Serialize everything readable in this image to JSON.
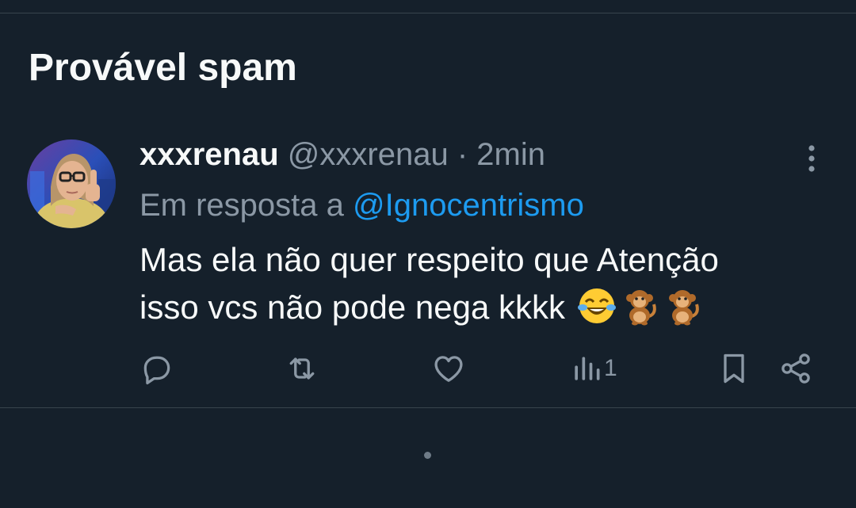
{
  "section": {
    "title": "Provável spam"
  },
  "tweet": {
    "display_name": "xxxrenau",
    "handle": "@xxxrenau",
    "separator": "·",
    "time": "2min",
    "reply_prefix": "Em resposta a",
    "reply_to": "@Ignocentrismo",
    "text_line1": "Mas ela não quer respeito que Atenção",
    "text_line2": "isso vcs não pode nega kkkk",
    "emojis": [
      "face-with-tears-of-joy",
      "monkey",
      "monkey"
    ],
    "views": "1"
  },
  "icons": {
    "reply": "reply-icon",
    "retweet": "retweet-icon",
    "like": "heart-icon",
    "views": "views-chart-icon",
    "bookmark": "bookmark-icon",
    "share": "share-icon",
    "more": "more-vertical-icon"
  },
  "colors": {
    "background": "#15202b",
    "text": "#f7f9f9",
    "muted": "#8b98a5",
    "accent": "#1d9bf0",
    "divider": "#38444d"
  }
}
